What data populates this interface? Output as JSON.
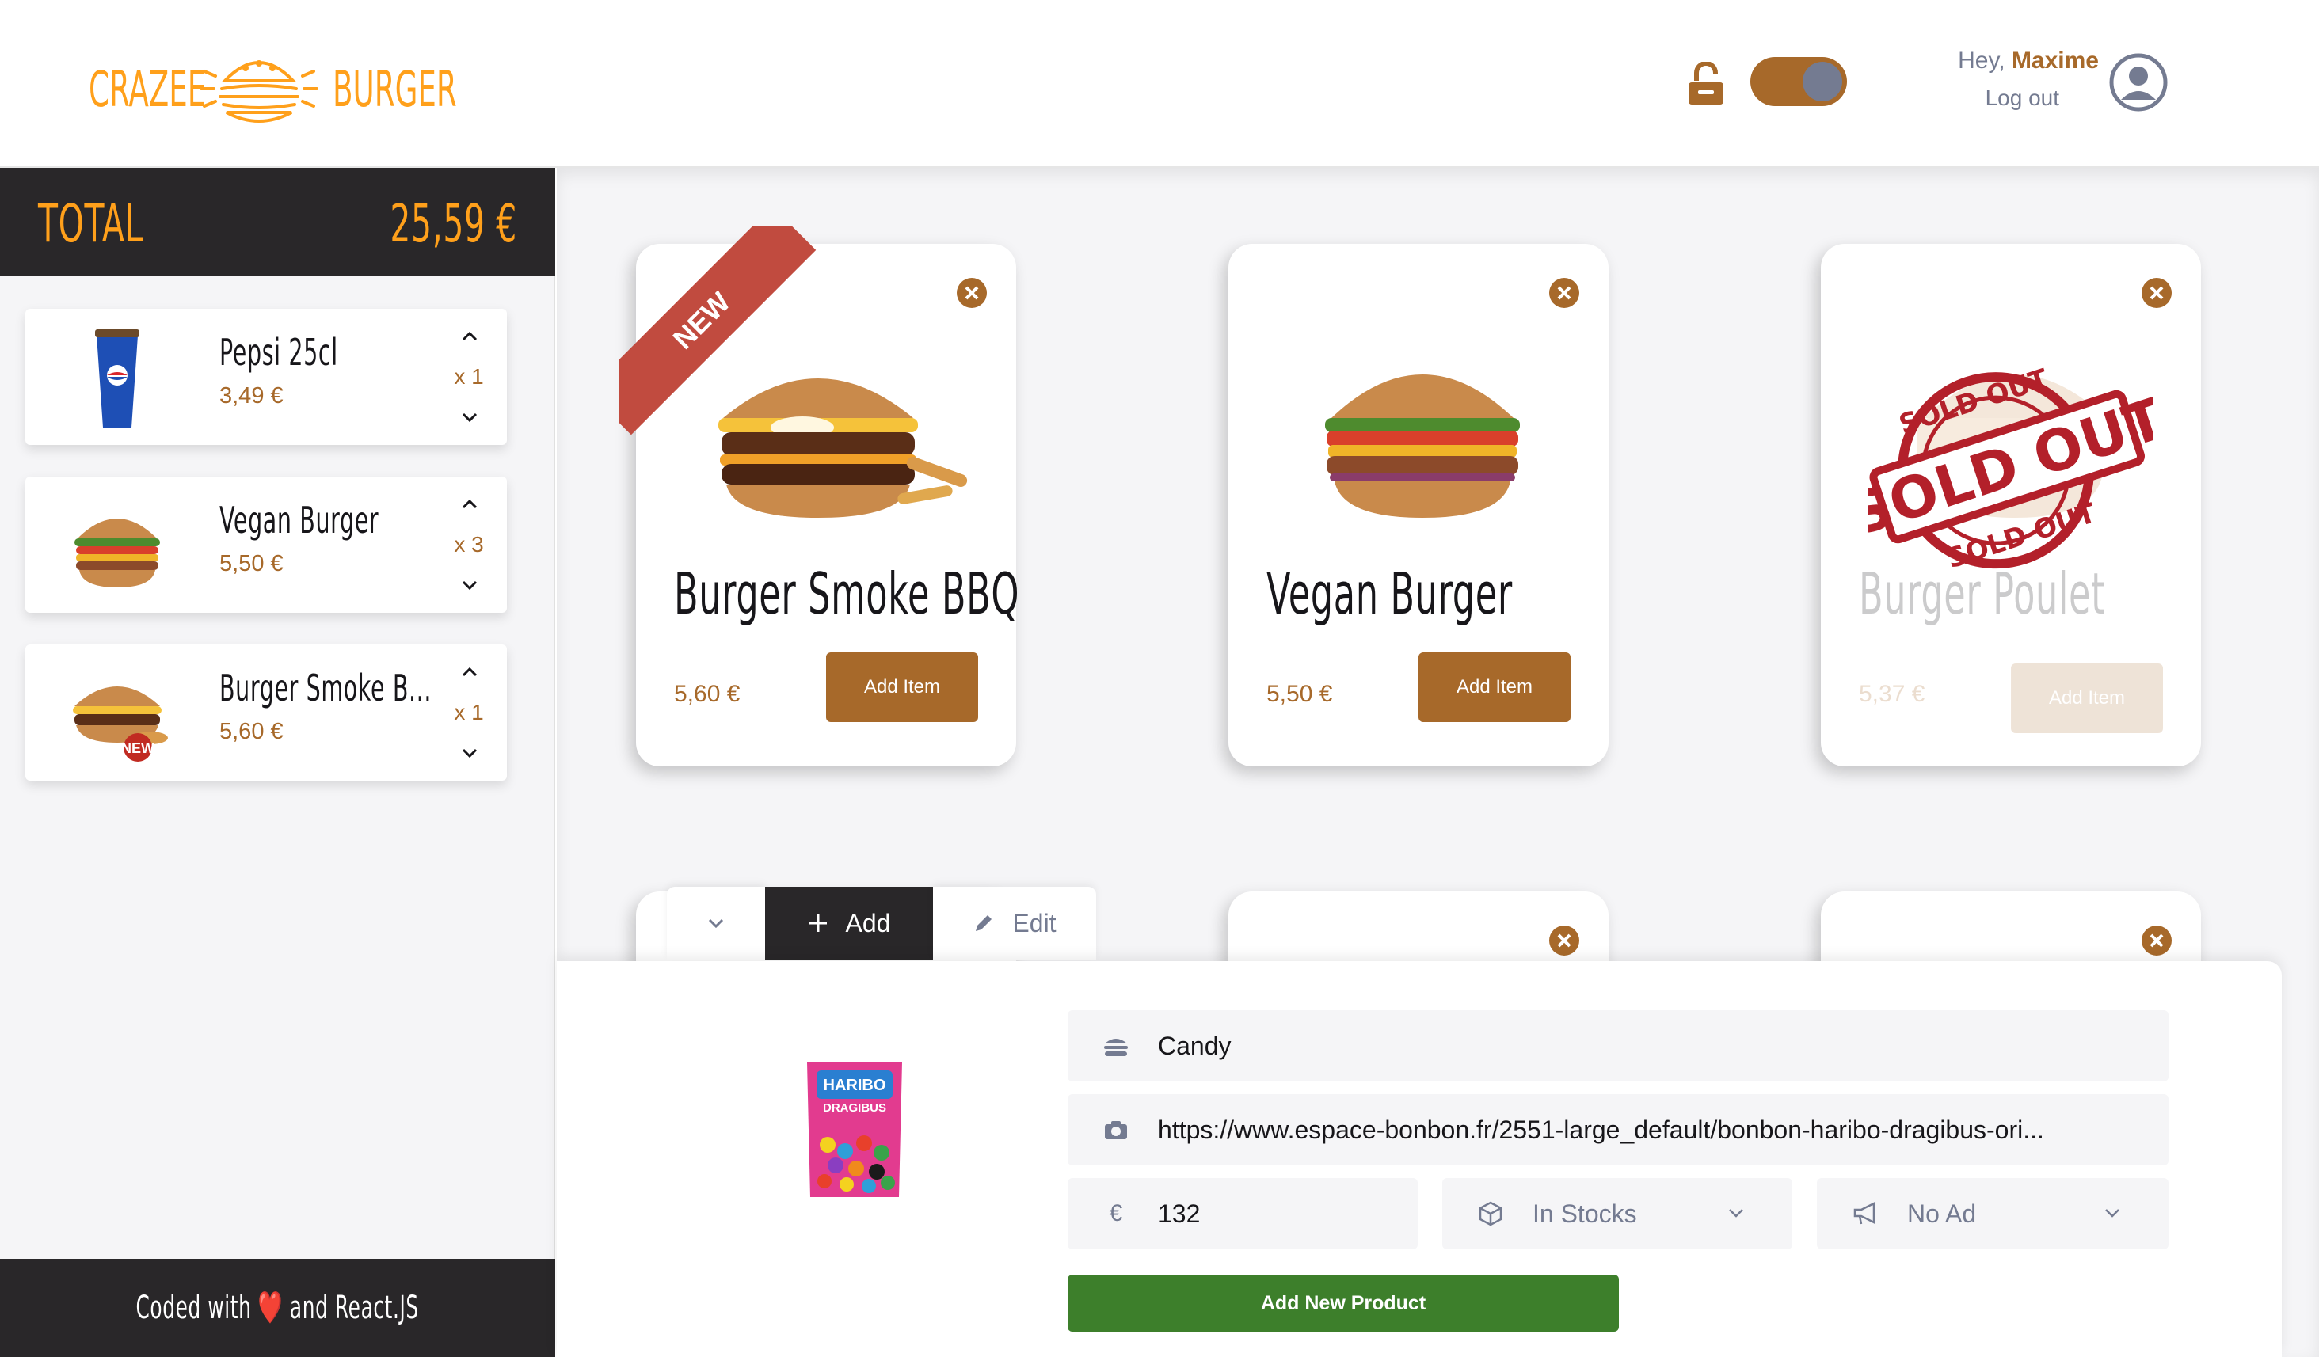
{
  "header": {
    "logo_left": "CRAZEE",
    "logo_right": "BURGER",
    "greeting": "Hey,",
    "username": "Maxime",
    "logout": "Log out"
  },
  "basket": {
    "total_label": "Total",
    "total_value": "25,59 €",
    "items": [
      {
        "name": "Pepsi 25cl",
        "price": "3,49 €",
        "qty": "x 1"
      },
      {
        "name": "Vegan Burger",
        "price": "5,50 €",
        "qty": "x 3"
      },
      {
        "name": "Burger Smoke B...",
        "price": "5,60 €",
        "qty": "x 1",
        "badge": "NEW"
      }
    ],
    "footer": "Coded with ❤️ and React.JS"
  },
  "menu": {
    "products": [
      {
        "title": "Burger Smoke BBQ",
        "price": "5,60 €",
        "button": "Add Item",
        "ribbon": "NEW"
      },
      {
        "title": "Vegan Burger",
        "price": "5,50 €",
        "button": "Add Item"
      },
      {
        "title": "Burger Poulet",
        "price": "5,37 €",
        "button": "Add Item",
        "stamp": "SOLD OUT",
        "stamp_sub": "SOLD OUT"
      }
    ]
  },
  "admin": {
    "tabs": {
      "add": "Add",
      "edit": "Edit"
    },
    "fields": {
      "name": "Candy",
      "image_url": "https://www.espace-bonbon.fr/2551-large_default/bonbon-haribo-dragibus-ori...",
      "price": "132",
      "stock": "In Stocks",
      "ad": "No Ad"
    },
    "preview_brand": "HARIBO",
    "preview_product": "DRAGIBUS",
    "submit": "Add New Product"
  },
  "colors": {
    "brand": "#ffa01b",
    "primary": "#a7692a",
    "dark": "#292729",
    "success": "#3d7f2b",
    "ribbon": "#c14b3f"
  }
}
